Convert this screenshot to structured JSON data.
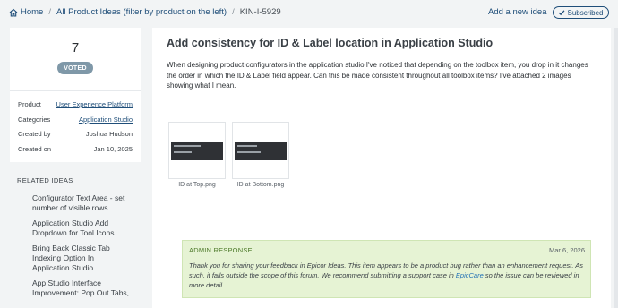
{
  "breadcrumb": {
    "home": "Home",
    "all_ideas": "All Product Ideas (filter by product on the left)",
    "current": "KIN-I-5929"
  },
  "header": {
    "add_idea": "Add a new idea",
    "subscribed": "Subscribed"
  },
  "vote": {
    "count": "7",
    "badge": "VOTED"
  },
  "meta": {
    "product_label": "Product",
    "product_value": "User Experience Platform",
    "categories_label": "Categories",
    "categories_value": "Application Studio",
    "created_by_label": "Created by",
    "created_by_value": "Joshua Hudson",
    "created_on_label": "Created on",
    "created_on_value": "Jan 10, 2025"
  },
  "related": {
    "title": "RELATED IDEAS",
    "items": [
      {
        "line1": "Configurator Text Area - set",
        "line2": "number of visible rows"
      },
      {
        "line1": "Application Studio Add",
        "line2": "Dropdown for Tool Icons"
      },
      {
        "line1": "Bring Back Classic Tab",
        "line2": "Indexing Option In",
        "line3": "Application Studio"
      },
      {
        "line1": "App Studio Interface",
        "line2": "Improvement: Pop Out Tabs,"
      }
    ]
  },
  "idea": {
    "title": "Add consistency for ID & Label location in Application Studio",
    "description": "When designing product configurators in the application studio I've noticed that depending on the toolbox item, you drop in it changes the order in which the ID & Label field appear. Can this be made consistent throughout all toolbox items? I've attached 2 images showing what I mean."
  },
  "attachments": [
    {
      "name": "ID at Top.png"
    },
    {
      "name": "ID at Bottom.png"
    }
  ],
  "admin": {
    "label": "ADMIN RESPONSE",
    "date": "Mar 6, 2026",
    "text_before": "Thank you for sharing your feedback in Epicor Ideas. This item appears to be a product bug rather than an enhancement request. As such, it falls outside the scope of this forum. We recommend submitting a support case in ",
    "link": "EpicCare",
    "text_after": " so the issue can be reviewed in more detail."
  },
  "colors": {
    "link": "#1f4e79",
    "badge": "#7f98a8",
    "admin_bg": "#e6f3d4",
    "admin_label": "#4d7a2a"
  }
}
